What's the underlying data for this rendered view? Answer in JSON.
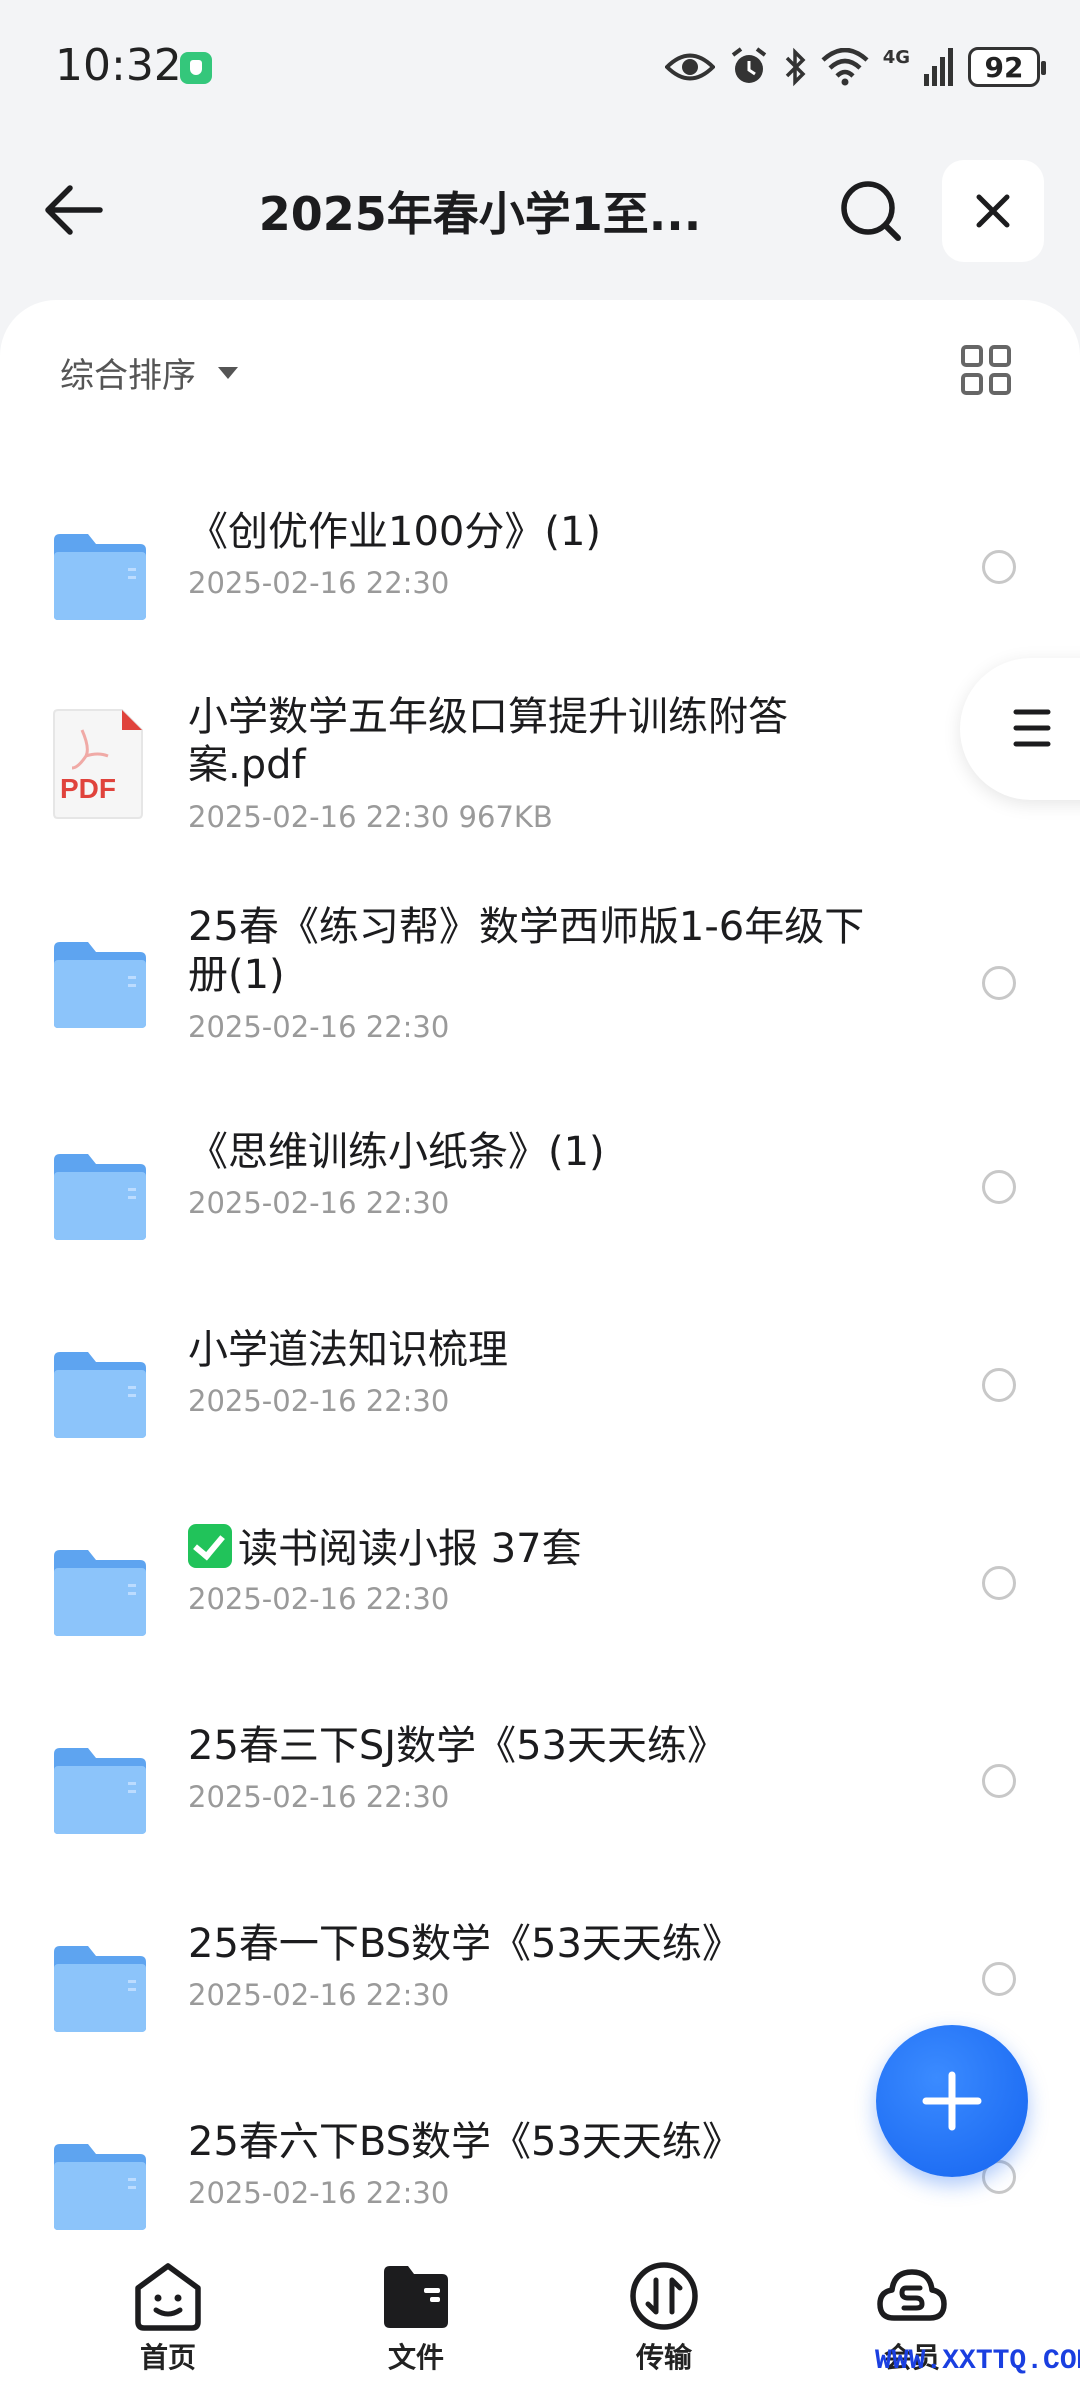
{
  "status_bar": {
    "time": "10:32",
    "network": "4G",
    "battery": "92"
  },
  "header": {
    "title": "2025年春小学1至..."
  },
  "sort": {
    "label": "综合排序"
  },
  "files": [
    {
      "type": "folder",
      "name": "《创优作业100分》(1)",
      "meta": "2025-02-16 22:30",
      "has_checkbox": true
    },
    {
      "type": "pdf",
      "name": "小学数学五年级口算提升训练附答案.pdf",
      "meta": "2025-02-16 22:30  967KB",
      "has_checkbox": false,
      "pdf_label": "PDF"
    },
    {
      "type": "folder",
      "name": "25春《练习帮》数学西师版1-6年级下册(1)",
      "meta": "2025-02-16 22:30",
      "has_checkbox": true
    },
    {
      "type": "folder",
      "name": "《思维训练小纸条》(1)",
      "meta": "2025-02-16 22:30",
      "has_checkbox": true
    },
    {
      "type": "folder",
      "name": " 小学道法知识梳理",
      "meta": "2025-02-16 22:30",
      "has_checkbox": true
    },
    {
      "type": "folder",
      "name": "读书阅读小报 37套",
      "meta": "2025-02-16 22:30",
      "has_checkbox": true,
      "prefix_icon": "green-check-icon"
    },
    {
      "type": "folder",
      "name": "25春三下SJ数学《53天天练》",
      "meta": "2025-02-16 22:30",
      "has_checkbox": true
    },
    {
      "type": "folder",
      "name": "25春一下BS数学《53天天练》",
      "meta": "2025-02-16 22:30",
      "has_checkbox": true
    },
    {
      "type": "folder",
      "name": "25春六下BS数学《53天天练》",
      "meta": "2025-02-16 22:30",
      "has_checkbox": true
    }
  ],
  "bottom_nav": [
    {
      "label": "首页",
      "icon": "home-smile-icon"
    },
    {
      "label": "文件",
      "icon": "folder-icon"
    },
    {
      "label": "传输",
      "icon": "transfer-icon"
    },
    {
      "label": "会员",
      "icon": "cloud-vip-icon"
    }
  ],
  "watermark": "WWW.XXTTQ.COM",
  "colors": {
    "accent": "#1564f0",
    "folder": "#7fbaf7",
    "pdf_red": "#e0433c",
    "check_green": "#21c35a"
  }
}
